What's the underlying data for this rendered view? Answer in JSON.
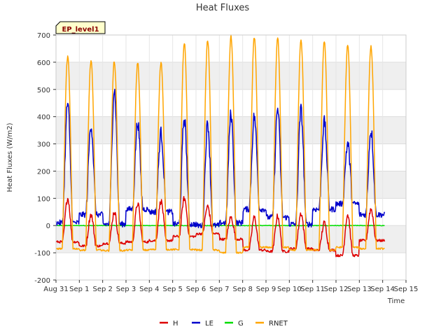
{
  "chart_data": {
    "type": "line",
    "title": "Heat Fluxes",
    "xlabel": "Time",
    "ylabel": "Heat Fluxes (W/m2)",
    "annotation": "EP_level1",
    "x_ticks": [
      "Aug 31",
      "Sep 1",
      "Sep 2",
      "Sep 3",
      "Sep 4",
      "Sep 5",
      "Sep 6",
      "Sep 7",
      "Sep 8",
      "Sep 9",
      "Sep 10",
      "Sep 11",
      "Sep 12",
      "Sep 13",
      "Sep 14",
      "Sep 15"
    ],
    "x_range_days": [
      0,
      15
    ],
    "ylim": [
      -200,
      700
    ],
    "y_ticks": [
      -200,
      -100,
      0,
      100,
      200,
      300,
      400,
      500,
      600,
      700
    ],
    "grid": true,
    "band_shading": true,
    "legend_position": "bottom-center",
    "series": [
      {
        "name": "H",
        "color": "#dd0000",
        "daily_peak": [
          100,
          40,
          50,
          80,
          90,
          100,
          70,
          30,
          30,
          35,
          45,
          10,
          40,
          60
        ],
        "night_level": [
          -60,
          -75,
          -65,
          -60,
          -55,
          -40,
          -30,
          -50,
          -90,
          -95,
          -85,
          -90,
          -110,
          -55
        ]
      },
      {
        "name": "LE",
        "color": "#0000cc",
        "daily_peak": [
          450,
          370,
          500,
          380,
          340,
          395,
          375,
          410,
          400,
          430,
          425,
          380,
          300,
          350
        ],
        "night_level": [
          10,
          40,
          5,
          60,
          50,
          5,
          0,
          10,
          60,
          30,
          5,
          60,
          80,
          40
        ]
      },
      {
        "name": "G",
        "color": "#00dd00",
        "daily_peak": [
          0,
          0,
          0,
          0,
          0,
          0,
          0,
          0,
          0,
          0,
          0,
          0,
          0,
          0
        ],
        "night_level": [
          0,
          0,
          0,
          0,
          0,
          0,
          0,
          0,
          0,
          0,
          0,
          0,
          0,
          0
        ]
      },
      {
        "name": "RNET",
        "color": "#ffa500",
        "daily_peak": [
          620,
          605,
          605,
          598,
          600,
          670,
          680,
          695,
          690,
          688,
          680,
          680,
          660,
          660
        ],
        "night_level": [
          -85,
          -90,
          -92,
          -90,
          -88,
          -88,
          -90,
          -100,
          -80,
          -80,
          -90,
          -90,
          -80,
          -85
        ]
      }
    ],
    "x_end_days": 14.1
  }
}
